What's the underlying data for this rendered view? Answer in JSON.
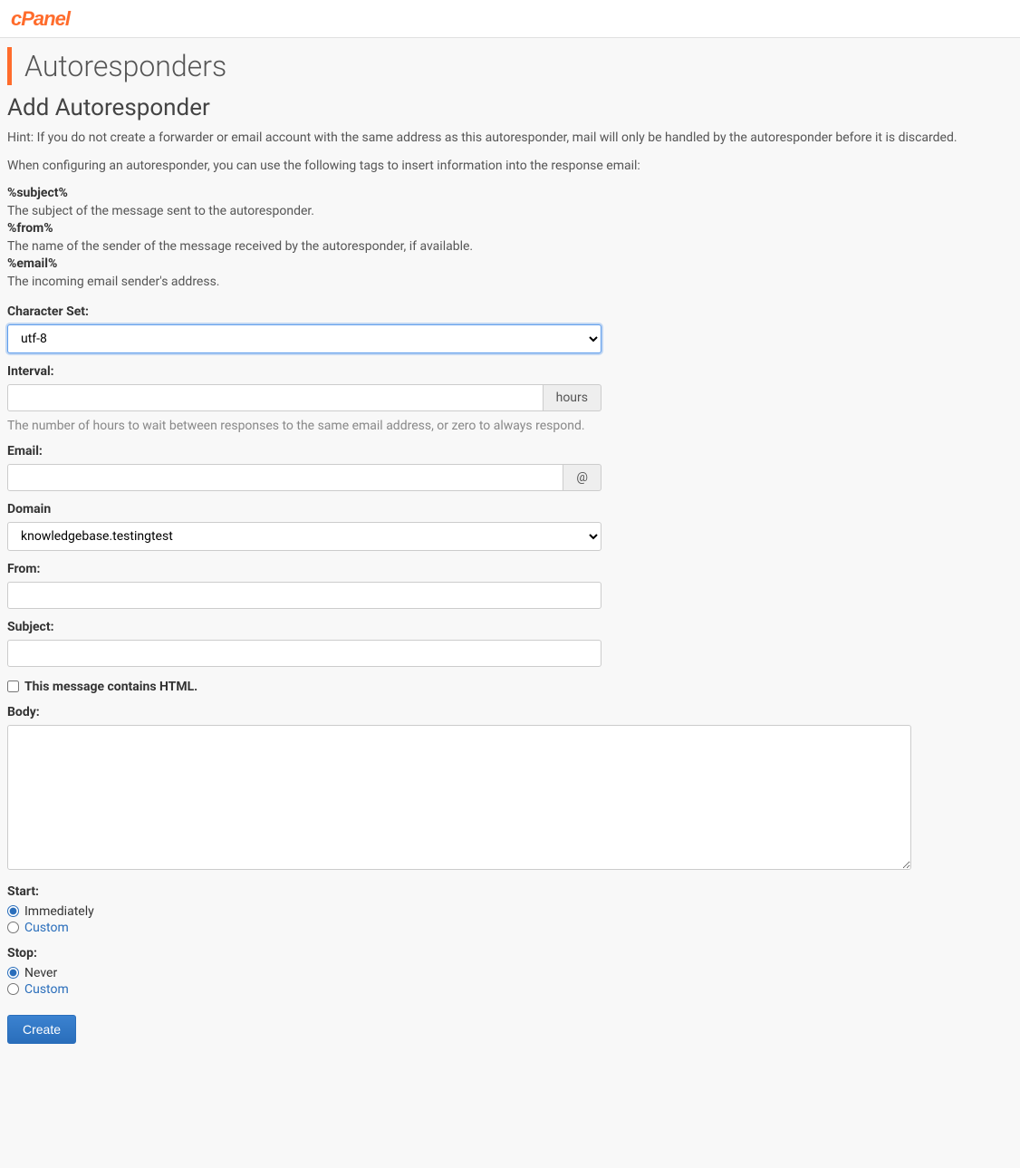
{
  "header": {
    "logo_text": "cPanel"
  },
  "page": {
    "title": "Autoresponders",
    "section_title": "Add Autoresponder",
    "hint": "Hint: If you do not create a forwarder or email account with the same address as this autoresponder, mail will only be handled by the autoresponder before it is discarded.",
    "tags_intro": "When configuring an autoresponder, you can use the following tags to insert information into the response email:",
    "tags": [
      {
        "name": "%subject%",
        "desc": "The subject of the message sent to the autoresponder."
      },
      {
        "name": "%from%",
        "desc": "The name of the sender of the message received by the autoresponder, if available."
      },
      {
        "name": "%email%",
        "desc": "The incoming email sender's address."
      }
    ]
  },
  "form": {
    "charset_label": "Character Set:",
    "charset_value": "utf-8",
    "interval_label": "Interval:",
    "interval_value": "",
    "interval_unit": "hours",
    "interval_help": "The number of hours to wait between responses to the same email address, or zero to always respond.",
    "email_label": "Email:",
    "email_value": "",
    "email_addon": "@",
    "domain_label": "Domain",
    "domain_value": "knowledgebase.testingtest",
    "from_label": "From:",
    "from_value": "",
    "subject_label": "Subject:",
    "subject_value": "",
    "html_checkbox_label": "This message contains HTML.",
    "html_checked": false,
    "body_label": "Body:",
    "body_value": "",
    "start_label": "Start:",
    "start_options": [
      {
        "label": "Immediately",
        "checked": true
      },
      {
        "label": "Custom",
        "checked": false
      }
    ],
    "stop_label": "Stop:",
    "stop_options": [
      {
        "label": "Never",
        "checked": true
      },
      {
        "label": "Custom",
        "checked": false
      }
    ],
    "submit_label": "Create"
  }
}
